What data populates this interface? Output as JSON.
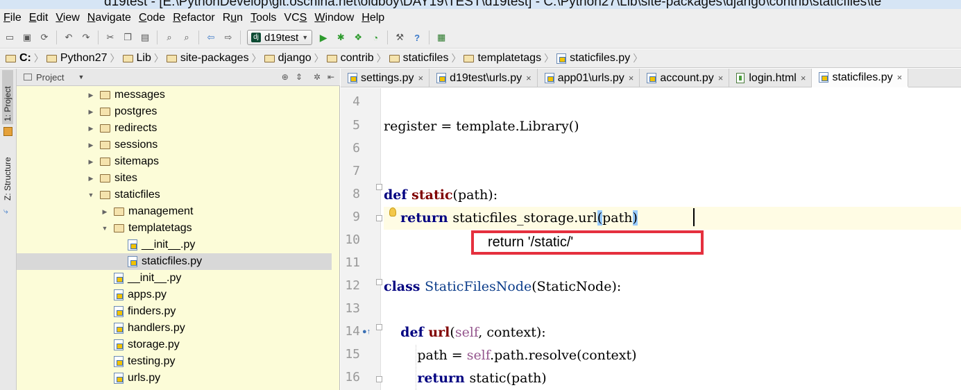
{
  "window": {
    "title": "d19test - [E:\\PythonDevelop\\git.oschina.net\\oldboy\\DAY19\\TEST\\d19test] - C:\\Python27\\Lib\\site-packages\\django\\contrib\\staticfiles\\te"
  },
  "menu": [
    {
      "pre": "",
      "u": "F",
      "post": "ile"
    },
    {
      "pre": "",
      "u": "E",
      "post": "dit"
    },
    {
      "pre": "",
      "u": "V",
      "post": "iew"
    },
    {
      "pre": "",
      "u": "N",
      "post": "avigate"
    },
    {
      "pre": "",
      "u": "C",
      "post": "ode"
    },
    {
      "pre": "",
      "u": "R",
      "post": "efactor"
    },
    {
      "pre": "R",
      "u": "u",
      "post": "n"
    },
    {
      "pre": "",
      "u": "T",
      "post": "ools"
    },
    {
      "pre": "VC",
      "u": "S",
      "post": ""
    },
    {
      "pre": "",
      "u": "W",
      "post": "indow"
    },
    {
      "pre": "",
      "u": "H",
      "post": "elp"
    }
  ],
  "toolbar": {
    "run_config": "d19test",
    "run_config_icon": "dj"
  },
  "breadcrumb": [
    "C:",
    "Python27",
    "Lib",
    "site-packages",
    "django",
    "contrib",
    "staticfiles",
    "templatetags",
    "staticfiles.py"
  ],
  "tool_windows": {
    "project": "1: Project",
    "structure": "Z: Structure"
  },
  "project_panel": {
    "title": "Project",
    "tree": [
      {
        "label": "messages",
        "kind": "folder",
        "depth": 0,
        "state": "collapsed"
      },
      {
        "label": "postgres",
        "kind": "folder",
        "depth": 0,
        "state": "collapsed"
      },
      {
        "label": "redirects",
        "kind": "folder",
        "depth": 0,
        "state": "collapsed"
      },
      {
        "label": "sessions",
        "kind": "folder",
        "depth": 0,
        "state": "collapsed"
      },
      {
        "label": "sitemaps",
        "kind": "folder",
        "depth": 0,
        "state": "collapsed"
      },
      {
        "label": "sites",
        "kind": "folder",
        "depth": 0,
        "state": "collapsed"
      },
      {
        "label": "staticfiles",
        "kind": "folder",
        "depth": 0,
        "state": "expanded"
      },
      {
        "label": "management",
        "kind": "folder",
        "depth": 1,
        "state": "collapsed"
      },
      {
        "label": "templatetags",
        "kind": "folder",
        "depth": 1,
        "state": "expanded"
      },
      {
        "label": "__init__.py",
        "kind": "py",
        "depth": 2,
        "state": "none"
      },
      {
        "label": "staticfiles.py",
        "kind": "py",
        "depth": 2,
        "state": "none",
        "selected": true
      },
      {
        "label": "__init__.py",
        "kind": "py",
        "depth": 1,
        "state": "none"
      },
      {
        "label": "apps.py",
        "kind": "py",
        "depth": 1,
        "state": "none"
      },
      {
        "label": "finders.py",
        "kind": "py",
        "depth": 1,
        "state": "none"
      },
      {
        "label": "handlers.py",
        "kind": "py",
        "depth": 1,
        "state": "none"
      },
      {
        "label": "storage.py",
        "kind": "py",
        "depth": 1,
        "state": "none"
      },
      {
        "label": "testing.py",
        "kind": "py",
        "depth": 1,
        "state": "none"
      },
      {
        "label": "urls.py",
        "kind": "py",
        "depth": 1,
        "state": "none"
      }
    ]
  },
  "tabs": [
    {
      "label": "settings.py",
      "kind": "py",
      "active": false
    },
    {
      "label": "d19test\\urls.py",
      "kind": "py",
      "active": false
    },
    {
      "label": "app01\\urls.py",
      "kind": "py",
      "active": false
    },
    {
      "label": "account.py",
      "kind": "py",
      "active": false
    },
    {
      "label": "login.html",
      "kind": "html",
      "active": false
    },
    {
      "label": "staticfiles.py",
      "kind": "py",
      "active": true
    }
  ],
  "editor": {
    "line_numbers": [
      "4",
      "5",
      "6",
      "7",
      "8",
      "9",
      "10",
      "11",
      "12",
      "13",
      "14",
      "15",
      "16"
    ],
    "current_line": "9",
    "annotation": "return '/static/'"
  },
  "colors": {
    "project_bg": "#fcfcd8",
    "current_line": "#fffce4",
    "annotation_border": "#e5303e",
    "keyword": "#000080"
  }
}
